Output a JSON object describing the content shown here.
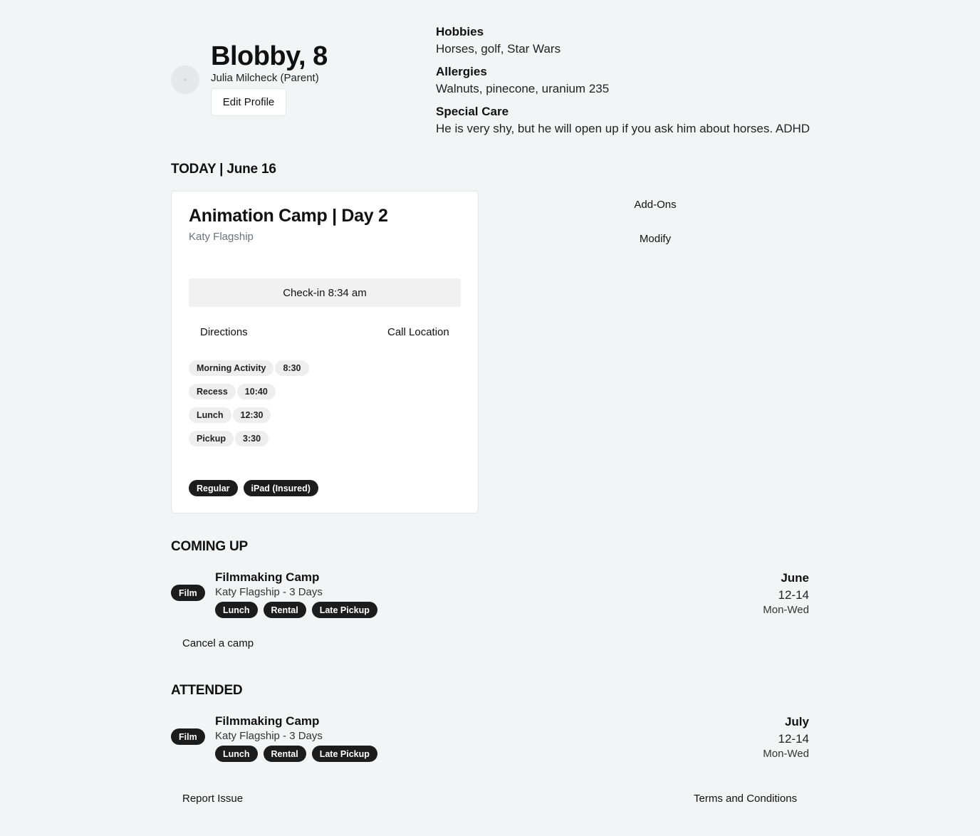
{
  "profile": {
    "name": "Blobby, 8",
    "parent": "Julia Milcheck (Parent)",
    "edit_label": "Edit Profile"
  },
  "info": {
    "hobbies_label": "Hobbies",
    "hobbies": "Horses, golf, Star Wars",
    "allergies_label": "Allergies",
    "allergies": "Walnuts, pinecone, uranium 235",
    "special_label": "Special Care",
    "special": "He is very shy, but he will open up if you ask him about horses. ADHD"
  },
  "today": {
    "heading": "TODAY | June 16",
    "title": "Animation Camp | Day 2",
    "location": "Katy Flagship",
    "checkin": "Check-in 8:34 am",
    "directions": "Directions",
    "call": "Call Location",
    "schedule": [
      {
        "label": "Morning Activity",
        "time": "8:30"
      },
      {
        "label": "Recess",
        "time": "10:40"
      },
      {
        "label": "Lunch",
        "time": "12:30"
      },
      {
        "label": "Pickup",
        "time": "3:30"
      }
    ],
    "tags": [
      "Regular",
      "iPad (Insured)"
    ],
    "addons": "Add-Ons",
    "modify": "Modify"
  },
  "coming_up": {
    "heading": "COMING UP",
    "category": "Film",
    "title": "Filmmaking Camp",
    "sub": "Katy Flagship - 3 Days",
    "tags": [
      "Lunch",
      "Rental",
      "Late Pickup"
    ],
    "month": "June",
    "days": "12-14",
    "dow": "Mon-Wed",
    "cancel": "Cancel a camp"
  },
  "attended": {
    "heading": "ATTENDED",
    "category": "Film",
    "title": "Filmmaking Camp",
    "sub": "Katy Flagship - 3 Days",
    "tags": [
      "Lunch",
      "Rental",
      "Late Pickup"
    ],
    "month": "July",
    "days": "12-14",
    "dow": "Mon-Wed"
  },
  "footer": {
    "report": "Report Issue",
    "terms": "Terms and Conditions"
  }
}
